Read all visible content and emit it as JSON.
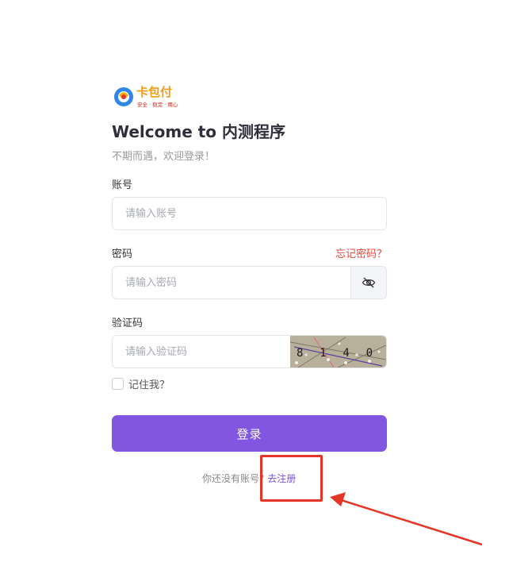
{
  "logo": {
    "brand_text": "卡包付",
    "slogan": "安全 · 稳定 · 用心",
    "icon": "logo-swirl-icon"
  },
  "header": {
    "title": "Welcome to 内测程序",
    "subtitle": "不期而遇，欢迎登录！"
  },
  "account": {
    "label": "账号",
    "placeholder": "请输入账号"
  },
  "password": {
    "label": "密码",
    "placeholder": "请输入密码",
    "forgot_label": "忘记密码？",
    "toggle_icon": "eye-off-icon"
  },
  "captcha": {
    "label": "验证码",
    "placeholder": "请输入验证码",
    "code_text": "8 1 4 0"
  },
  "remember": {
    "label": "记住我？",
    "checked": false
  },
  "login_button": {
    "label": "登录"
  },
  "register": {
    "prompt": "你还没有账号?",
    "link_label": "去注册"
  },
  "colors": {
    "accent": "#8256e0",
    "link": "#7a4fd8",
    "forgot": "#e5483d",
    "annotation": "#e53528"
  }
}
